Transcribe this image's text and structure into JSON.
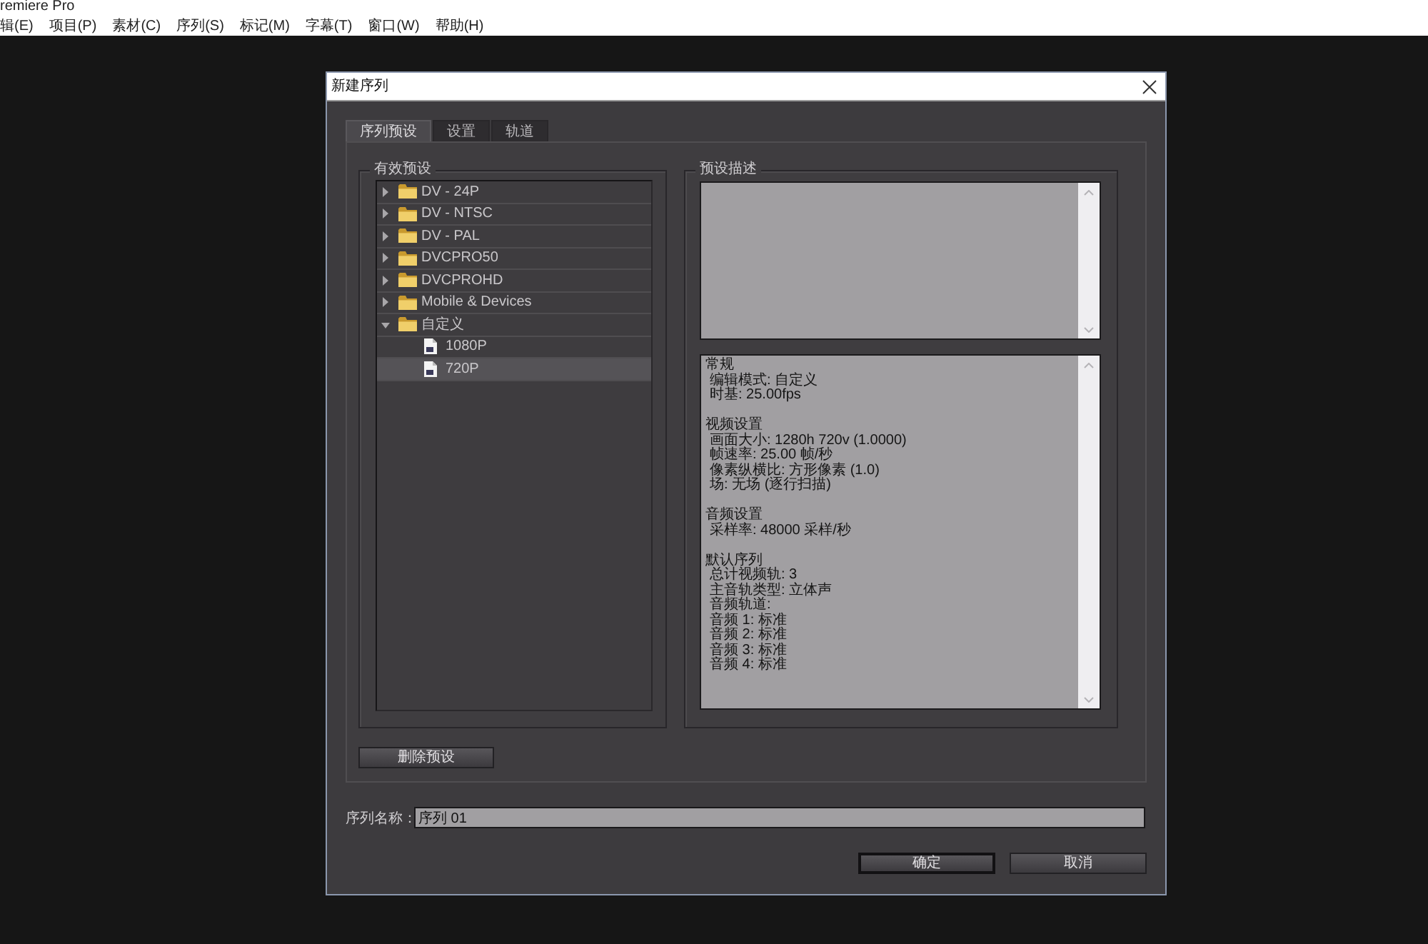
{
  "app": {
    "title": "remiere Pro"
  },
  "menu_bar": [
    "辑(E)",
    "项目(P)",
    "素材(C)",
    "序列(S)",
    "标记(M)",
    "字幕(T)",
    "窗口(W)",
    "帮助(H)"
  ],
  "dialog": {
    "title": "新建序列"
  },
  "tabs": [
    {
      "label": "序列预设",
      "selected": true
    },
    {
      "label": "设置",
      "selected": false
    },
    {
      "label": "轨道",
      "selected": false
    }
  ],
  "presets": {
    "legend": "有效预设",
    "tree": [
      {
        "label": "DV - 24P",
        "kind": "folder",
        "expanded": false,
        "selected": false
      },
      {
        "label": "DV - NTSC",
        "kind": "folder",
        "expanded": false,
        "selected": false
      },
      {
        "label": "DV - PAL",
        "kind": "folder",
        "expanded": false,
        "selected": false
      },
      {
        "label": "DVCPRO50",
        "kind": "folder",
        "expanded": false,
        "selected": false
      },
      {
        "label": "DVCPROHD",
        "kind": "folder",
        "expanded": false,
        "selected": false
      },
      {
        "label": "Mobile & Devices",
        "kind": "folder",
        "expanded": false,
        "selected": false
      },
      {
        "label": "自定义",
        "kind": "folder",
        "expanded": true,
        "selected": false,
        "children": [
          {
            "label": "1080P",
            "kind": "file",
            "selected": false
          },
          {
            "label": "720P",
            "kind": "file",
            "selected": true
          }
        ]
      }
    ],
    "delete_button": "删除预设"
  },
  "description": {
    "legend": "预设描述",
    "sections": [
      {
        "heading": "常规",
        "lines": [
          "编辑模式: 自定义",
          "时基: 25.00fps"
        ]
      },
      {
        "heading": "视频设置",
        "lines": [
          "画面大小: 1280h 720v (1.0000)",
          "帧速率: 25.00 帧/秒",
          "像素纵横比: 方形像素 (1.0)",
          "场: 无场 (逐行扫描)"
        ]
      },
      {
        "heading": "音频设置",
        "lines": [
          "采样率: 48000 采样/秒"
        ]
      },
      {
        "heading": "默认序列",
        "lines": [
          "总计视频轨: 3",
          "主音轨类型: 立体声",
          "音频轨道:",
          "音频 1: 标准",
          "音频 2: 标准",
          "音频 3: 标准",
          "音频 4: 标准"
        ]
      }
    ]
  },
  "sequence_name": {
    "label": "序列名称：",
    "value": "序列 01"
  },
  "buttons": [
    {
      "label": "确定",
      "default": true
    },
    {
      "label": "取消",
      "default": false
    }
  ]
}
